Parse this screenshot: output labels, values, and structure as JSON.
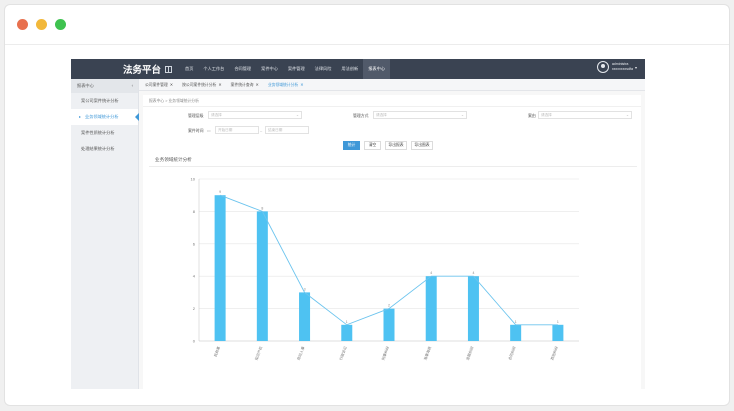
{
  "window": {
    "controls": [
      "close",
      "minimize",
      "zoom"
    ]
  },
  "app": {
    "brand": "法务平台",
    "nav": [
      "首页",
      "个人工作台",
      "合同管理",
      "案件中心",
      "案件管理",
      "法律风险",
      "用法创新",
      "报表中心"
    ],
    "nav_active_index": 7,
    "user": {
      "line1": "administra",
      "line2": "xxxxxxxxsdfa"
    }
  },
  "sidebar": {
    "header": "报表中心",
    "items": [
      "案公司案件统计分析",
      "业务领域统计分析",
      "案件性质统计分析",
      "处理结果统计分析"
    ],
    "active_index": 1
  },
  "tabs": [
    {
      "label": "公司案件管理",
      "active": false
    },
    {
      "label": "按公司案件统计分析",
      "active": false
    },
    {
      "label": "案件统计查询",
      "active": false
    },
    {
      "label": "业务领域统计分析",
      "active": true
    }
  ],
  "breadcrumb": "报表中心 > 业务领域统计分析",
  "filters": {
    "row1": [
      {
        "label": "管理层级",
        "placeholder": "请选择"
      },
      {
        "label": "管理方式",
        "placeholder": "请选择"
      },
      {
        "label": "案由",
        "placeholder": "请选择"
      }
    ],
    "date": {
      "label": "案件时间",
      "start": "开始日期",
      "end": "结束日期"
    },
    "buttons": [
      "统计",
      "清空",
      "导出报表",
      "导出图表"
    ]
  },
  "chart_title": "业务领域统计分析",
  "colors": {
    "bar": "#4ec2f2",
    "line": "#6cc4ee",
    "primary": "#3f98d8",
    "header": "#3a4352"
  },
  "chart_data": {
    "type": "bar",
    "categories": [
      "民商事",
      "知识产权",
      "劳动人事",
      "行政诉讼",
      "刑事纠纷",
      "海事海商",
      "金融纠纷",
      "合同纠纷",
      "其他纠纷"
    ],
    "values": [
      9,
      8,
      3,
      1,
      2,
      4,
      4,
      1,
      1
    ],
    "line_overlay": true,
    "ylim": [
      0,
      10
    ],
    "yticks": [
      0,
      2,
      4,
      6,
      8,
      10
    ],
    "data_labels": [
      "9",
      "8",
      "3",
      "1",
      "2",
      "4",
      "4",
      "1",
      "1"
    ],
    "grid": true
  }
}
